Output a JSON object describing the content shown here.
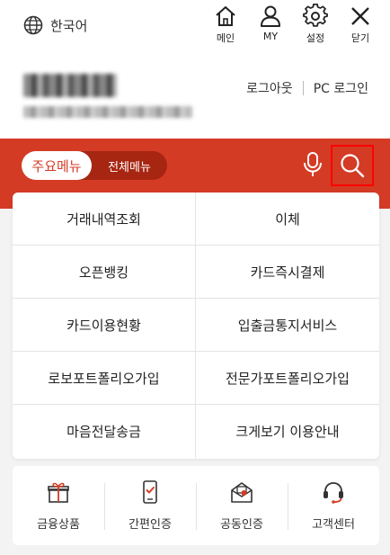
{
  "header": {
    "language": "한국어",
    "icons": [
      {
        "label": "메인",
        "icon": "home-icon"
      },
      {
        "label": "MY",
        "icon": "person-icon"
      },
      {
        "label": "설정",
        "icon": "gear-icon"
      },
      {
        "label": "닫기",
        "icon": "close-icon"
      }
    ]
  },
  "account": {
    "logout": "로그아웃",
    "pc_login": "PC 로그인"
  },
  "menu_tabs": {
    "primary": "주요메뉴",
    "all": "전체메뉴"
  },
  "menu_items": [
    "거래내역조회",
    "이체",
    "오픈뱅킹",
    "카드즉시결제",
    "카드이용현황",
    "입출금통지서비스",
    "로보포트폴리오가입",
    "전문가포트폴리오가입",
    "마음전달송금",
    "크게보기 이용안내"
  ],
  "quick_links": [
    {
      "label": "금융상품",
      "icon": "gift-icon"
    },
    {
      "label": "간편인증",
      "icon": "phone-check-icon"
    },
    {
      "label": "공동인증",
      "icon": "certificate-mail-icon"
    },
    {
      "label": "고객센터",
      "icon": "headset-icon"
    }
  ],
  "colors": {
    "accent": "#d43b25",
    "pill_dark": "#a72612",
    "highlight_box": "#ff0000"
  }
}
